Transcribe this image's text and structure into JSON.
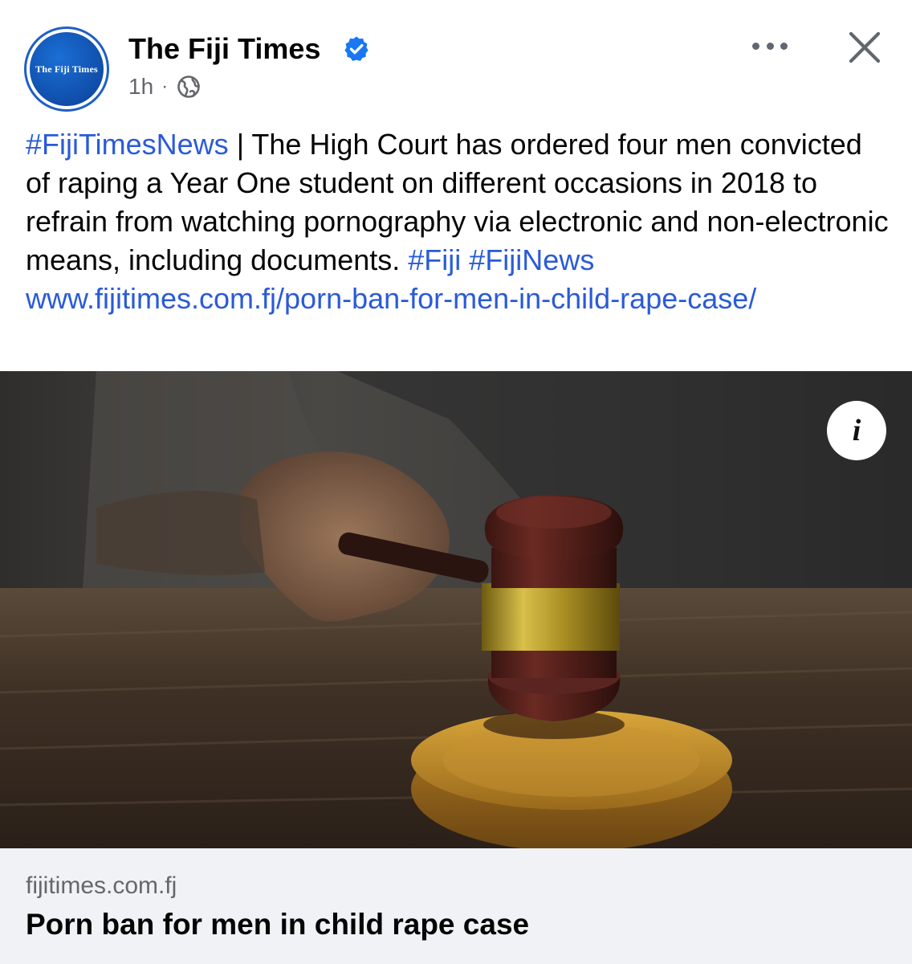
{
  "page": {
    "name": "The Fiji Times",
    "avatar_text": "The Fiji Times",
    "verified": true,
    "timestamp": "1h",
    "separator": "·",
    "audience_icon": "globe-icon"
  },
  "actions": {
    "more_icon": "more-horizontal-icon",
    "close_icon": "close-icon"
  },
  "post": {
    "hashtag_lead": "#FijiTimesNews",
    "body": " | The High Court has ordered four men convicted of raping a Year One student on different occasions in 2018 to refrain from watching pornography via electronic and non-electronic means, including documents. ",
    "hashtag_1": "#Fiji",
    "hashtag_2": "#FijiNews",
    "url": "www.fijitimes.com.fj/porn-ban-for-men-in-child-rape-case/"
  },
  "image": {
    "description_icon": "info-icon",
    "info_label": "i"
  },
  "link_preview": {
    "domain": "fijitimes.com.fj",
    "title": "Porn ban for men in child rape case"
  },
  "colors": {
    "link": "#2a5bd7",
    "verified_badge": "#1877f2",
    "secondary_text": "#65676b",
    "preview_bg": "#f0f2f5"
  }
}
